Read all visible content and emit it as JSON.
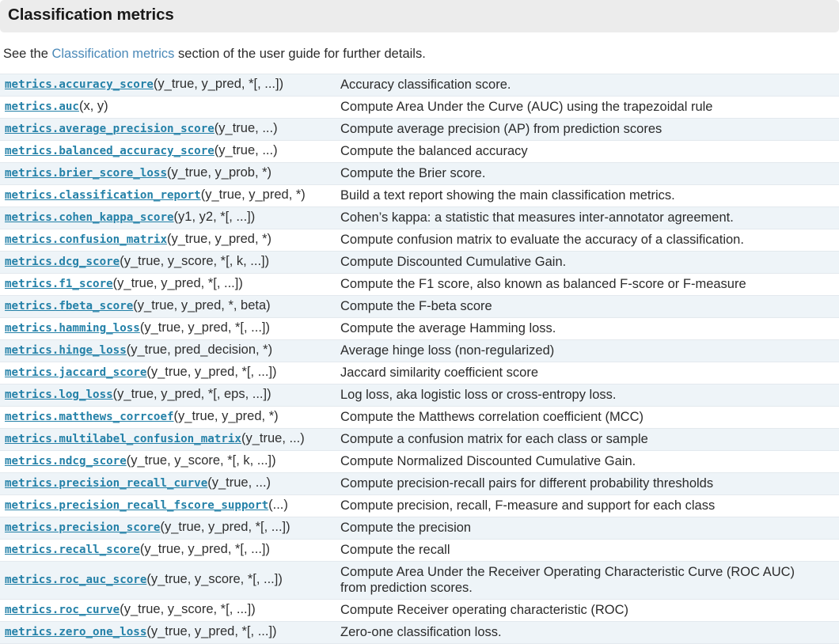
{
  "header": {
    "title": "Classification metrics"
  },
  "intro": {
    "before": "See the ",
    "link": "Classification metrics",
    "after": " section of the user guide for further details."
  },
  "colors": {
    "header_bg": "#ececec",
    "row_shaded_bg": "#eef4f8",
    "row_plain_bg": "#ffffff",
    "row_border": "#e3e9ee",
    "code_link": "#2481a8",
    "text_link": "#4a89b8",
    "body_text": "#2b2b2b"
  },
  "table": {
    "rows": [
      {
        "name": "metrics.accuracy_score",
        "args": "(y_true, y_pred, *[, ...])",
        "desc": "Accuracy classification score.",
        "desc2": ""
      },
      {
        "name": "metrics.auc",
        "args": "(x, y)",
        "desc": "Compute Area Under the Curve (AUC) using the trapezoidal rule",
        "desc2": ""
      },
      {
        "name": "metrics.average_precision_score",
        "args": "(y_true, ...)",
        "desc": "Compute average precision (AP) from prediction scores",
        "desc2": ""
      },
      {
        "name": "metrics.balanced_accuracy_score",
        "args": "(y_true, ...)",
        "desc": "Compute the balanced accuracy",
        "desc2": ""
      },
      {
        "name": "metrics.brier_score_loss",
        "args": "(y_true, y_prob, *)",
        "desc": "Compute the Brier score.",
        "desc2": ""
      },
      {
        "name": "metrics.classification_report",
        "args": "(y_true, y_pred, *)",
        "desc": "Build a text report showing the main classification metrics.",
        "desc2": ""
      },
      {
        "name": "metrics.cohen_kappa_score",
        "args": "(y1, y2, *[, ...])",
        "desc": "Cohen’s kappa: a statistic that measures inter-annotator agreement.",
        "desc2": ""
      },
      {
        "name": "metrics.confusion_matrix",
        "args": "(y_true, y_pred, *)",
        "desc": "Compute confusion matrix to evaluate the accuracy of a classification.",
        "desc2": ""
      },
      {
        "name": "metrics.dcg_score",
        "args": "(y_true, y_score, *[, k, ...])",
        "desc": "Compute Discounted Cumulative Gain.",
        "desc2": ""
      },
      {
        "name": "metrics.f1_score",
        "args": "(y_true, y_pred, *[, ...])",
        "desc": "Compute the F1 score, also known as balanced F-score or F-measure",
        "desc2": ""
      },
      {
        "name": "metrics.fbeta_score",
        "args": "(y_true, y_pred, *, beta)",
        "desc": "Compute the F-beta score",
        "desc2": ""
      },
      {
        "name": "metrics.hamming_loss",
        "args": "(y_true, y_pred, *[, ...])",
        "desc": "Compute the average Hamming loss.",
        "desc2": ""
      },
      {
        "name": "metrics.hinge_loss",
        "args": "(y_true, pred_decision, *)",
        "desc": "Average hinge loss (non-regularized)",
        "desc2": ""
      },
      {
        "name": "metrics.jaccard_score",
        "args": "(y_true, y_pred, *[, ...])",
        "desc": "Jaccard similarity coefficient score",
        "desc2": ""
      },
      {
        "name": "metrics.log_loss",
        "args": "(y_true, y_pred, *[, eps, ...])",
        "desc": "Log loss, aka logistic loss or cross-entropy loss.",
        "desc2": ""
      },
      {
        "name": "metrics.matthews_corrcoef",
        "args": "(y_true, y_pred, *)",
        "desc": "Compute the Matthews correlation coefficient (MCC)",
        "desc2": ""
      },
      {
        "name": "metrics.multilabel_confusion_matrix",
        "args": "(y_true, ...)",
        "desc": "Compute a confusion matrix for each class or sample",
        "desc2": ""
      },
      {
        "name": "metrics.ndcg_score",
        "args": "(y_true, y_score, *[, k, ...])",
        "desc": "Compute Normalized Discounted Cumulative Gain.",
        "desc2": ""
      },
      {
        "name": "metrics.precision_recall_curve",
        "args": "(y_true, ...)",
        "desc": "Compute precision-recall pairs for different probability thresholds",
        "desc2": ""
      },
      {
        "name": "metrics.precision_recall_fscore_support",
        "args": "(...)",
        "desc": "Compute precision, recall, F-measure and support for each class",
        "desc2": ""
      },
      {
        "name": "metrics.precision_score",
        "args": "(y_true, y_pred, *[, ...])",
        "desc": "Compute the precision",
        "desc2": ""
      },
      {
        "name": "metrics.recall_score",
        "args": "(y_true, y_pred, *[, ...])",
        "desc": "Compute the recall",
        "desc2": ""
      },
      {
        "name": "metrics.roc_auc_score",
        "args": "(y_true, y_score, *[, ...])",
        "desc": "Compute Area Under the Receiver Operating Characteristic Curve (ROC AUC)",
        "desc2": "from prediction scores."
      },
      {
        "name": "metrics.roc_curve",
        "args": "(y_true, y_score, *[, ...])",
        "desc": "Compute Receiver operating characteristic (ROC)",
        "desc2": ""
      },
      {
        "name": "metrics.zero_one_loss",
        "args": "(y_true, y_pred, *[, ...])",
        "desc": "Zero-one classification loss.",
        "desc2": ""
      }
    ]
  }
}
